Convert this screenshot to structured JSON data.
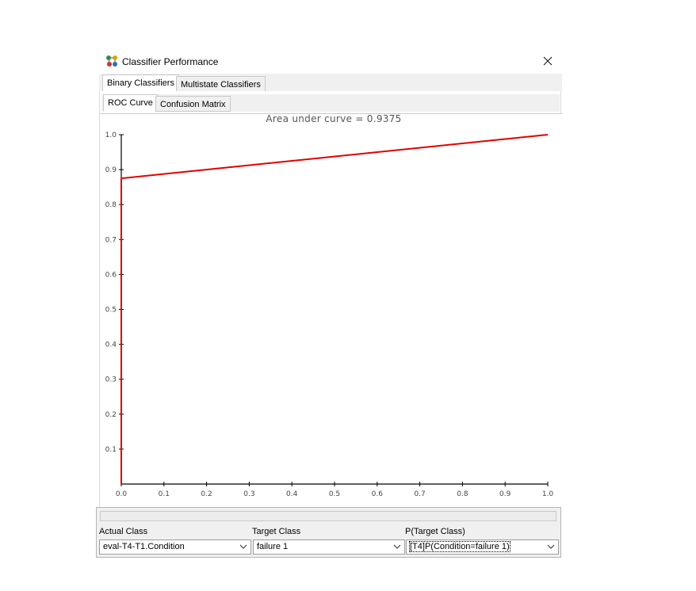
{
  "window": {
    "title": "Classifier Performance",
    "icon": "network-nodes-icon"
  },
  "tabs": [
    {
      "label": "Binary Classifiers",
      "active": true
    },
    {
      "label": "Multistate Classifiers",
      "active": false
    }
  ],
  "subtabs": [
    {
      "label": "ROC Curve",
      "active": true
    },
    {
      "label": "Confusion Matrix",
      "active": false
    }
  ],
  "chart_data": {
    "type": "line",
    "title": "Area under curve = 0.9375",
    "xlabel": "",
    "ylabel": "",
    "xlim": [
      0.0,
      1.0
    ],
    "ylim": [
      0.0,
      1.0
    ],
    "x_ticks": [
      "0.0",
      "0.1",
      "0.2",
      "0.3",
      "0.4",
      "0.5",
      "0.6",
      "0.7",
      "0.8",
      "0.9",
      "1.0"
    ],
    "y_ticks": [
      "0.1",
      "0.2",
      "0.3",
      "0.4",
      "0.5",
      "0.6",
      "0.7",
      "0.8",
      "0.9",
      "1.0"
    ],
    "grid": false,
    "series": [
      {
        "color": "#e00000",
        "x": [
          0.0,
          0.0,
          1.0
        ],
        "y": [
          0.0,
          0.875,
          1.0
        ]
      }
    ]
  },
  "controls": {
    "actual_class_label": "Actual Class",
    "actual_class_value": "eval-T4-T1.Condition",
    "target_class_label": "Target Class",
    "target_class_value": "failure 1",
    "p_target_label": "P(Target Class)",
    "p_target_value": "[T4]P(Condition=failure 1)"
  }
}
